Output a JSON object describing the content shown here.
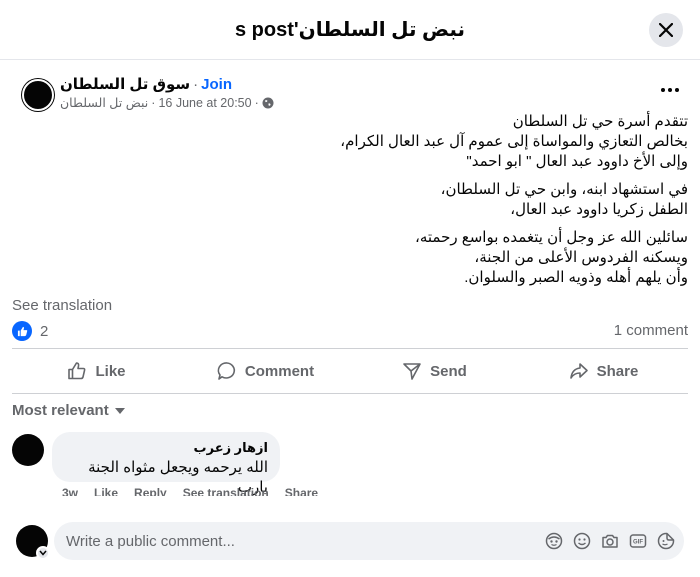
{
  "header": {
    "title": "نبض تل السلطان's post"
  },
  "post": {
    "group_name": "سوق تل السلطان",
    "join_label": "Join",
    "author_name": "نبض تل السلطان",
    "timestamp": "16 June at 20:50",
    "body_paragraphs": [
      "تتقدم أسرة حي تل السلطان\nبخالص التعازي والمواساة إلى عموم آل عبد العال الكرام،\nوإلى الأخ داوود عبد العال    \" ابو احمد\"",
      "في استشهاد ابنه، وابن حي تل السلطان،\nالطفل زكريا داوود عبد العال،",
      "سائلين الله عز وجل أن يتغمده بواسع رحمته،\nويسكنه الفردوس الأعلى من الجنة،\nوأن يلهم أهله وذويه الصبر والسلوان."
    ],
    "see_translation": "See translation",
    "reaction_count": "2",
    "comments_count": "1 comment"
  },
  "actions": {
    "like": "Like",
    "comment": "Comment",
    "send": "Send",
    "share": "Share"
  },
  "comments_section": {
    "sort_label": "Most relevant",
    "comments": [
      {
        "author": "ازهار زعرب",
        "text": "الله يرحمه ويجعل مثواه الجنة يارب",
        "time": "3w",
        "like": "Like",
        "reply": "Reply",
        "see_translation": "See translation",
        "share": "Share"
      }
    ]
  },
  "composer": {
    "placeholder": "Write a public comment..."
  },
  "colors": {
    "accent": "#0866ff",
    "secondary_text": "#65676b",
    "bubble_bg": "#f0f2f5"
  }
}
